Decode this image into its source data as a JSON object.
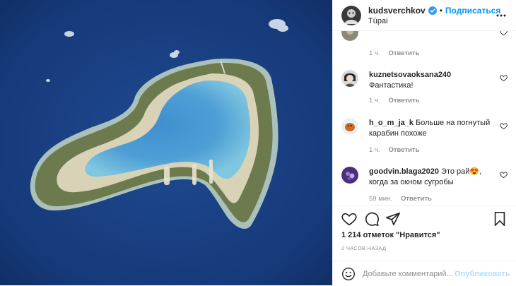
{
  "header": {
    "username": "kudsverchkov",
    "separator": "•",
    "follow_label": "Подписаться",
    "location": "Tūpai",
    "more_icon": "more-horizontal-icon",
    "verified_icon": "verified-badge-icon"
  },
  "comments": [
    {
      "username": "",
      "text": "",
      "time": "1 ч.",
      "reply": "Ответить"
    },
    {
      "username": "kuznetsovaoksana240",
      "text": "Фантастика!",
      "time": "1 ч.",
      "reply": "Ответить"
    },
    {
      "username": "h_o_m_ja_k",
      "text": "Больше на погнутый карабин похоже",
      "time": "1 ч.",
      "reply": "Ответить"
    },
    {
      "username": "goodvin.blaga2020",
      "text": "Это рай😍, когда за окном сугробы",
      "time": "59 мин.",
      "reply": "Ответить"
    }
  ],
  "actions": {
    "like_icon": "heart-icon",
    "comment_icon": "comment-icon",
    "share_icon": "paper-plane-icon",
    "save_icon": "bookmark-icon",
    "likes_text": "1 214 отметок \"Нравится\"",
    "time_ago": "2 часов назад"
  },
  "add_comment": {
    "emoji_icon": "smiley-icon",
    "placeholder": "Добавьте комментарий...",
    "publish_label": "Опубликовать"
  },
  "colors": {
    "accent": "#0095f6",
    "publish_disabled": "#b2dffc",
    "ocean": "#1a3a7a"
  }
}
